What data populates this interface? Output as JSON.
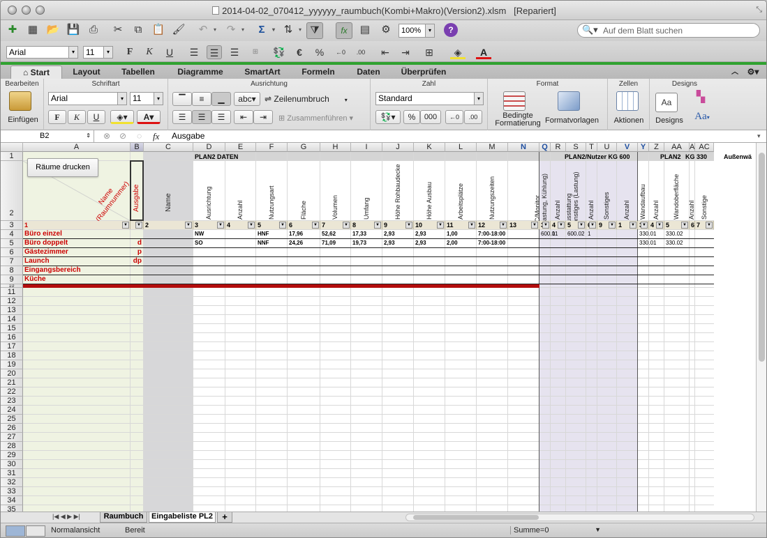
{
  "window": {
    "title": "2014-04-02_070412_yyyyyy_raumbuch(Kombi+Makro)(Version2).xlsm",
    "title_suffix": "[Repariert]"
  },
  "toolbar": {
    "zoom": "100%",
    "help_label": "?",
    "search_placeholder": "Auf dem Blatt suchen"
  },
  "format_bar": {
    "font": "Arial",
    "size": "11",
    "bold": "F",
    "italic": "K",
    "underline": "U",
    "euro": "€",
    "percent": "%"
  },
  "ribbon_tabs": [
    "Start",
    "Layout",
    "Tabellen",
    "Diagramme",
    "SmartArt",
    "Formeln",
    "Daten",
    "Überprüfen"
  ],
  "ribbon": {
    "groups": {
      "bearbeiten": "Bearbeiten",
      "schriftart": "Schriftart",
      "ausrichtung": "Ausrichtung",
      "zahl": "Zahl",
      "format": "Format",
      "zellen": "Zellen",
      "designs": "Designs"
    },
    "einfuegen": "Einfügen",
    "font": "Arial",
    "size": "11",
    "bold": "F",
    "italic": "K",
    "underline": "U",
    "abc": "abc",
    "wrap": "Zeilenumbruch",
    "merge": "Zusammenführen",
    "number_format": "Standard",
    "percent": "%",
    "thousands": "000",
    "cond_format_1": "Bedingte",
    "cond_format_2": "Formatierung",
    "styles": "Formatvorlagen",
    "actions": "Aktionen",
    "designs": "Designs",
    "font_aa": "Aa"
  },
  "formula_bar": {
    "cell_ref": "B2",
    "fx": "fx",
    "value": "Ausgabe"
  },
  "columns": [
    "A",
    "B",
    "C",
    "D",
    "E",
    "F",
    "G",
    "H",
    "I",
    "J",
    "K",
    "L",
    "M",
    "N",
    "Q",
    "R",
    "S",
    "T",
    "U",
    "V",
    "Y",
    "Z",
    "AA",
    "AB",
    "AC"
  ],
  "rows": [
    "1",
    "2",
    "3",
    "4",
    "5",
    "6",
    "7",
    "8",
    "9",
    "10",
    "11",
    "12",
    "13",
    "14",
    "15",
    "16",
    "17",
    "18",
    "19",
    "20",
    "21",
    "22",
    "23",
    "24",
    "25",
    "26",
    "27",
    "28",
    "29",
    "30",
    "31",
    "32",
    "33",
    "34",
    "35"
  ],
  "sheet": {
    "print_button": "Räume drucken",
    "plan2_daten": "PLAN2 DATEN",
    "plan2_nutzer": "PLAN2/Nutzer KG 600",
    "plan2": "PLAN2",
    "kg330": "KG 330",
    "aussenw": "Außenwä",
    "name_raum_1": "Name",
    "name_raum_2": "(Raumnummer)",
    "ausgabe": "Ausgabe",
    "name": "Name",
    "headers": [
      "Ausrichtung",
      "Anzahl",
      "Nutzungsart",
      "Fläche",
      "Volumen",
      "Umfang",
      "Höhe Rohbaudecke",
      "Höhe Ausbau",
      "Arbeitsplätze",
      "Nutzungszeiten"
    ],
    "headers_q": [
      "PC/Monitor (Lastung, Kühlung)",
      "Anzahl",
      "Ausstattung sonstiges (Lastung)",
      "Anzahl",
      "Sonstiges",
      "Anzahl"
    ],
    "headers_y": [
      "Wandaufbau",
      "Anzahl",
      "Wandoberfläche",
      "Anzahl",
      "Sonstige"
    ],
    "filter_row": [
      "1",
      "",
      "2",
      "3",
      "4",
      "5",
      "6",
      "7",
      "8",
      "9",
      "10",
      "11",
      "12",
      "13",
      "3",
      "4",
      "5",
      "6",
      "9",
      "1",
      "3",
      "4",
      "5",
      "6",
      "7"
    ],
    "rooms": [
      {
        "name": "Büro einzel",
        "code": ""
      },
      {
        "name": "Büro doppelt",
        "code": "d"
      },
      {
        "name": "Gästezimmer",
        "code": "p"
      },
      {
        "name": "Launch",
        "code": "dp"
      },
      {
        "name": "Eingangsbereich",
        "code": ""
      },
      {
        "name": "Küche",
        "code": ""
      }
    ],
    "row4": {
      "D": "NW",
      "F": "HNF",
      "G": "17,96",
      "H": "52,62",
      "I": "17,33",
      "J": "2,93",
      "K": "2,93",
      "L": "1,00",
      "M": "7:00-18:00",
      "Q": "600.01",
      "R": "1",
      "S": "600.02",
      "T": "1",
      "Y": "330.01",
      "AA": "330.02"
    },
    "row5": {
      "D": "SO",
      "F": "NNF",
      "G": "24,26",
      "H": "71,09",
      "I": "19,73",
      "J": "2,93",
      "K": "2,93",
      "L": "2,00",
      "M": "7:00-18:00",
      "Y": "330.01",
      "AA": "330.02"
    }
  },
  "sheet_tabs": [
    "Raumbuch",
    "Eingabeliste PL2"
  ],
  "status": {
    "view": "Normalansicht",
    "state": "Bereit",
    "sum": "Summe=0"
  }
}
